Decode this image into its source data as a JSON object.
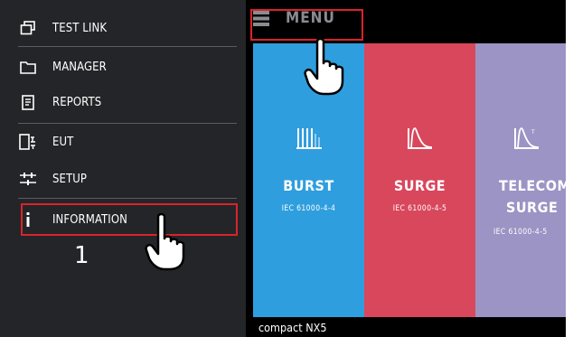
{
  "sidebar": {
    "items": [
      {
        "label": "TEST LINK",
        "icon": "windows-icon"
      },
      {
        "label": "MANAGER",
        "icon": "folder-icon"
      },
      {
        "label": "REPORTS",
        "icon": "document-icon"
      },
      {
        "label": "EUT",
        "icon": "device-icon"
      },
      {
        "label": "SETUP",
        "icon": "sliders-icon"
      },
      {
        "label": "INFORMATION",
        "icon": "info-icon"
      }
    ]
  },
  "annotation": {
    "step_number": "1"
  },
  "menu": {
    "label": "MENU",
    "icon": "menu-icon"
  },
  "tiles": [
    {
      "name": "BURST",
      "standard": "IEC 61000-4-4",
      "color": "#2f9ede"
    },
    {
      "name": "SURGE",
      "standard": "IEC 61000-4-5",
      "color": "#d9475c"
    },
    {
      "name_line1": "TELECOM",
      "name_line2": "SURGE",
      "standard": "IEC 61000-4-5",
      "color": "#9b94c4"
    }
  ],
  "footer": {
    "device_name": "compact NX5"
  },
  "colors": {
    "highlight": "#d9232a",
    "sidebar_bg": "#242528"
  }
}
